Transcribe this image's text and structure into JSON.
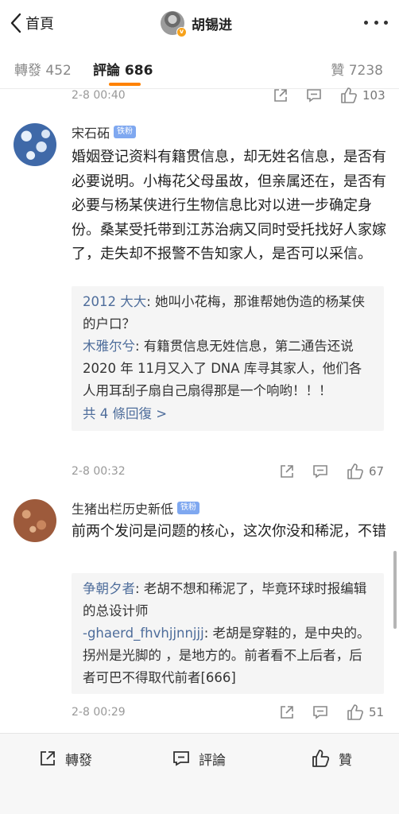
{
  "header": {
    "back_label": "首頁",
    "user_name": "胡锡进",
    "avatar_badge": "v",
    "icons": [
      "chevron-left-icon",
      "more-dots-icon"
    ]
  },
  "tabs": {
    "repost": "轉發 452",
    "comment": "評論 686",
    "like": "贊 7238",
    "accent_color": "#ff8200"
  },
  "top_meta": {
    "time": "2-8 00:40",
    "likes": "103"
  },
  "comments": [
    {
      "name": "宋石砳",
      "badge": "铁粉",
      "text": "婚姻登记资料有籍贯信息，却无姓名信息，是否有必要说明。小梅花父母虽故，但亲属还在，是否有必要与杨某侠进行生物信息比对以进一步确定身份。桑某受托带到江苏治病又同时受托找好人家嫁了，走失却不报警不告知家人，是否可以采信。",
      "replies": [
        {
          "who": "2012 大大",
          "text": ": 她叫小花梅，那谁帮她伪造的杨某侠的户口？"
        },
        {
          "who": "木雅尔兮",
          "text": ": 有籍贯信息无姓信息，第二通告还说 2020 年 11月又入了 DNA 库寻其家人，他们各人用耳刮子扇自己扇得那是一个响哟！！！"
        }
      ],
      "more_replies": "共 4 條回復 >",
      "time": "2-8 00:32",
      "likes": "67"
    },
    {
      "name": "生猪出栏历史新低",
      "badge": "铁粉",
      "text": "前两个发问是问题的核心，这次你没和稀泥，不错",
      "replies": [
        {
          "who": "争朝夕者",
          "text": ": 老胡不想和稀泥了，毕竟环球时报编辑的总设计师"
        },
        {
          "who": "-ghaerd_fhvhjjnnjjj",
          "text": ": 老胡是穿鞋的，是中央的。拐州是光脚的 ，是地方的。前者看不上后者，后者可巴不得取代前者[666]"
        }
      ],
      "time": "2-8 00:29",
      "likes": "51"
    }
  ],
  "bottom_bar": {
    "repost": "轉發",
    "comment": "評論",
    "like": "贊"
  },
  "colors": {
    "link": "#4e6d9b",
    "badge": "#7fa8f0",
    "reply_bg": "#f5f5f5"
  }
}
